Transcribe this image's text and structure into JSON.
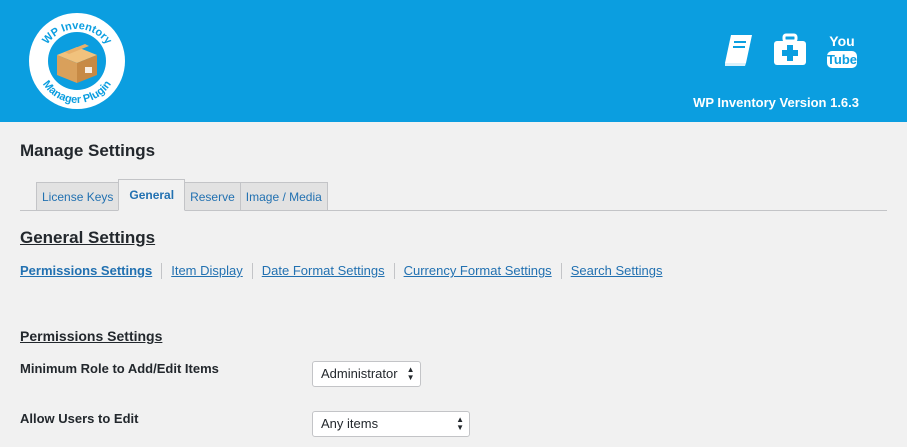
{
  "header": {
    "logo_text": "WP Inventory Manager Plugin",
    "version": "WP Inventory Version 1.6.3",
    "icons": [
      "book-icon",
      "first-aid-kit-icon",
      "youtube-icon"
    ],
    "youtube_label_top": "You",
    "youtube_label_bottom": "Tube",
    "bg_color": "#0b9ee0"
  },
  "page": {
    "title": "Manage Settings"
  },
  "tabs": [
    {
      "label": "License Keys",
      "active": false
    },
    {
      "label": "General",
      "active": true
    },
    {
      "label": "Reserve",
      "active": false
    },
    {
      "label": "Image / Media",
      "active": false
    }
  ],
  "general": {
    "title": "General Settings",
    "subnav": [
      "Permissions Settings",
      "Item Display",
      "Date Format Settings",
      "Currency Format Settings",
      "Search Settings"
    ]
  },
  "permissions": {
    "title": "Permissions Settings",
    "fields": [
      {
        "label": "Minimum Role to Add/Edit Items",
        "value": "Administrator"
      },
      {
        "label": "Allow Users to Edit",
        "value": "Any items"
      }
    ]
  }
}
